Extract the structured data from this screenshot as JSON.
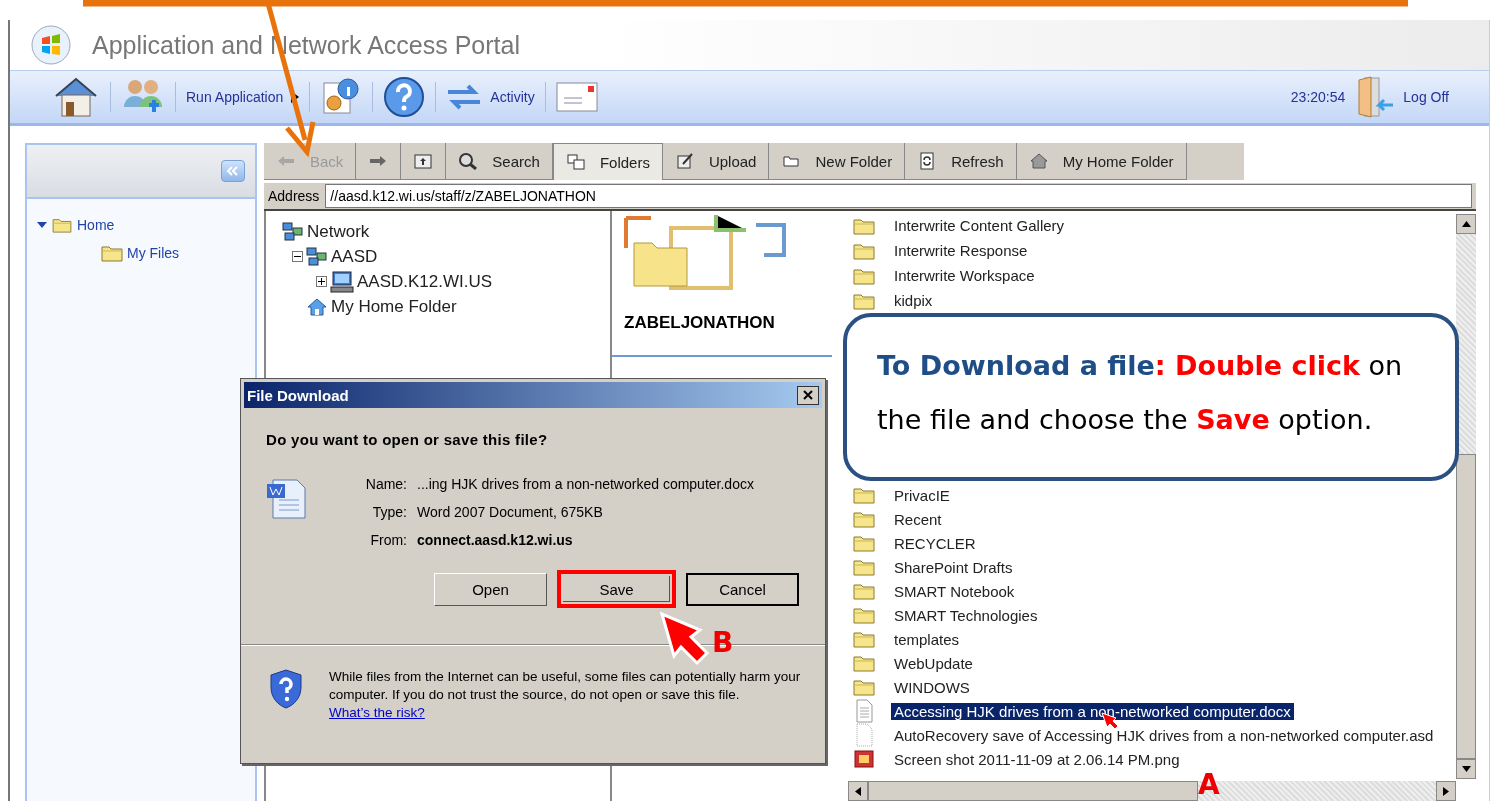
{
  "window": {
    "title": "Application and Network Access Portal"
  },
  "toolbar": {
    "run_application": "Run Application",
    "activity": "Activity",
    "clock": "23:20:54",
    "log_off": "Log Off"
  },
  "sidebar": {
    "tree": [
      {
        "label": "Home",
        "expanded": true,
        "children": [
          {
            "label": "My Files"
          }
        ]
      }
    ]
  },
  "explorer_toolbar": [
    {
      "kind": "back",
      "label": "Back",
      "disabled": true,
      "selected": false
    },
    {
      "kind": "forward",
      "disabled": false,
      "selected": false
    },
    {
      "kind": "up",
      "disabled": false,
      "selected": false
    },
    {
      "kind": "search",
      "label": "Search",
      "disabled": false,
      "selected": false
    },
    {
      "kind": "folders",
      "label": "Folders",
      "disabled": false,
      "selected": true
    },
    {
      "kind": "upload",
      "label": "Upload",
      "disabled": false,
      "selected": false
    },
    {
      "kind": "new-folder",
      "label": "New Folder",
      "disabled": false,
      "selected": false
    },
    {
      "kind": "refresh",
      "label": "Refresh",
      "disabled": false,
      "selected": false
    },
    {
      "kind": "home-folder",
      "label": "My Home Folder",
      "disabled": false,
      "selected": false
    }
  ],
  "address": {
    "label": "Address",
    "value": "//aasd.k12.wi.us/staff/z/ZABELJONATHON"
  },
  "folder_tree": [
    {
      "kind": "network",
      "label": "Network",
      "children": [
        {
          "kind": "network",
          "label": "AASD",
          "expanded": true,
          "children": [
            {
              "kind": "computer",
              "label": "AASD.K12.WI.US",
              "expanded": false
            }
          ]
        },
        {
          "kind": "home",
          "label": "My Home Folder"
        }
      ]
    }
  ],
  "folder_panel": {
    "name": "ZABELJONATHON"
  },
  "files": [
    {
      "kind": "folder",
      "name": "Interwrite Content Gallery",
      "selected": false
    },
    {
      "kind": "folder",
      "name": "Interwrite Response",
      "selected": false
    },
    {
      "kind": "folder",
      "name": "Interwrite Workspace",
      "selected": false
    },
    {
      "kind": "folder",
      "name": "kidpix",
      "selected": false
    },
    {
      "kind": "gap"
    },
    {
      "kind": "folder",
      "name": "PrivacIE",
      "selected": false
    },
    {
      "kind": "folder",
      "name": "Recent",
      "selected": false
    },
    {
      "kind": "folder",
      "name": "RECYCLER",
      "selected": false
    },
    {
      "kind": "folder",
      "name": "SharePoint Drafts",
      "selected": false
    },
    {
      "kind": "folder",
      "name": "SMART Notebook",
      "selected": false
    },
    {
      "kind": "folder",
      "name": "SMART Technologies",
      "selected": false
    },
    {
      "kind": "folder",
      "name": "templates",
      "selected": false
    },
    {
      "kind": "folder",
      "name": "WebUpdate",
      "selected": false
    },
    {
      "kind": "folder",
      "name": "WINDOWS",
      "selected": false
    },
    {
      "kind": "document",
      "name": "Accessing HJK drives from a non-networked computer.docx",
      "selected": true
    },
    {
      "kind": "blank",
      "name": "AutoRecovery save of Accessing HJK drives from a non-networked computer.asd",
      "selected": false
    },
    {
      "kind": "image",
      "name": "Screen shot 2011-11-09 at 2.06.14 PM.png",
      "selected": false
    }
  ],
  "dialog": {
    "title": "File Download",
    "question": "Do you want to open or save this file?",
    "fields": [
      {
        "label": "Name:",
        "value": "...ing HJK drives from a non-networked computer.docx",
        "bold": false
      },
      {
        "label": "Type:",
        "value": "Word 2007 Document, 675KB",
        "bold": false
      },
      {
        "label": "From:",
        "value": "connect.aasd.k12.wi.us",
        "bold": true
      }
    ],
    "buttons": [
      {
        "label": "Open",
        "default": false,
        "highlighted": false
      },
      {
        "label": "Save",
        "default": false,
        "highlighted": true
      },
      {
        "label": "Cancel",
        "default": true,
        "highlighted": false
      }
    ],
    "warning": "While files from the Internet can be useful, some files can potentially harm your computer. If you do not trust the source, do not open or save this file.",
    "risk_link": "What’s the risk?"
  },
  "callout": {
    "parts": [
      {
        "kind": "heading",
        "text": "To Download a file"
      },
      {
        "kind": "emphasis",
        "text": ": Double click"
      },
      {
        "kind": "plain",
        "text": " on the file and choose the "
      },
      {
        "kind": "emphasis",
        "text": "Save"
      },
      {
        "kind": "plain",
        "text": " option."
      }
    ]
  },
  "markers": {
    "save": "B",
    "file": "A"
  }
}
